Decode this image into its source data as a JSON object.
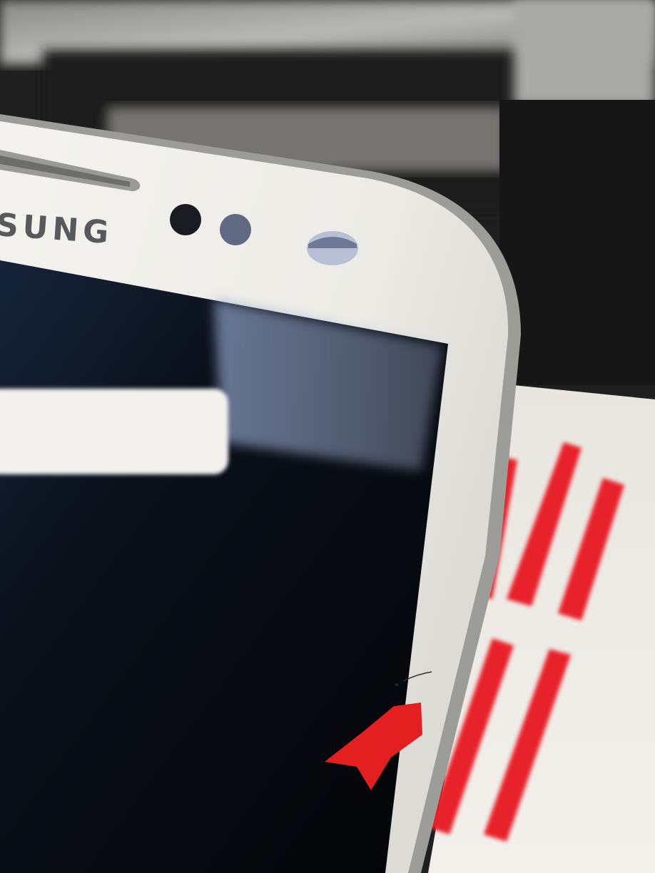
{
  "photo": {
    "subject": "phone-corner-closeup",
    "brand_text": "SUNG",
    "colors": {
      "bezel": "#f1f0ec",
      "screen": "#050608",
      "tape": "#e8212a",
      "backdrop_dark": "#1c1c1c"
    }
  }
}
